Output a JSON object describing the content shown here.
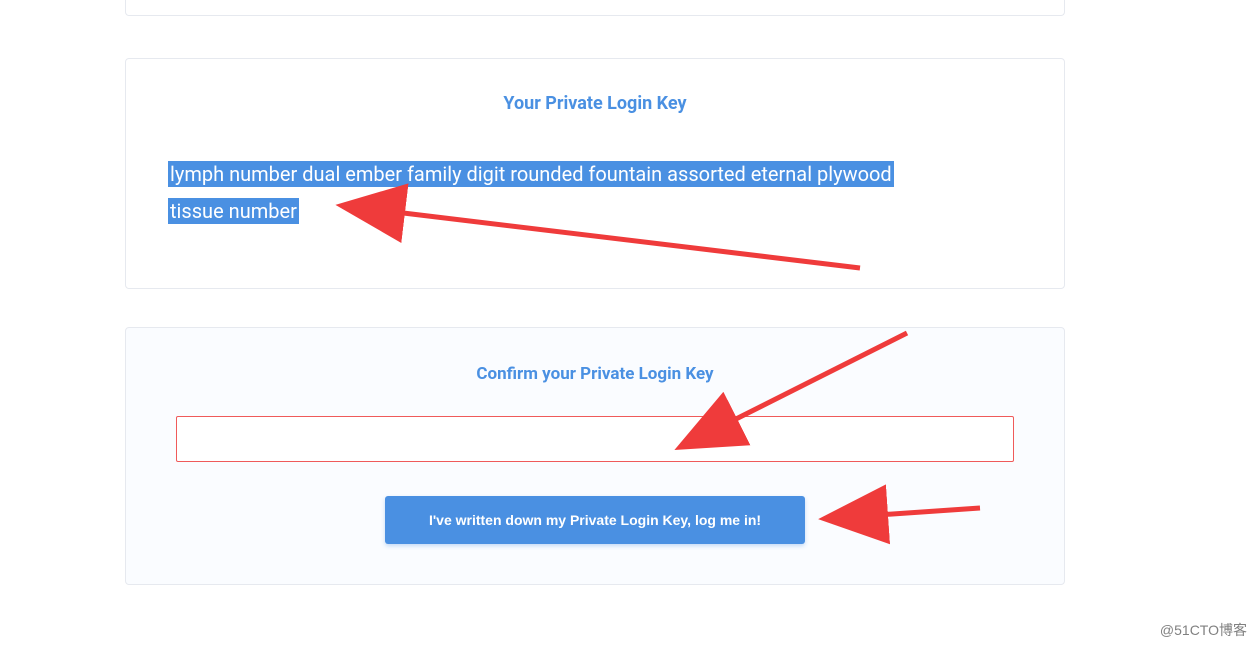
{
  "keyCard": {
    "title": "Your Private Login Key",
    "mnemonicLine1": "lymph number dual ember family digit rounded fountain assorted eternal plywood ",
    "mnemonicLine2": "tissue number"
  },
  "confirmCard": {
    "title": "Confirm your Private Login Key",
    "inputValue": "",
    "buttonLabel": "I've written down my Private Login Key, log me in!"
  },
  "watermark": "@51CTO博客",
  "colors": {
    "accent": "#4a90e2",
    "error": "#ef5a5a",
    "arrow": "#ef3b3b"
  }
}
